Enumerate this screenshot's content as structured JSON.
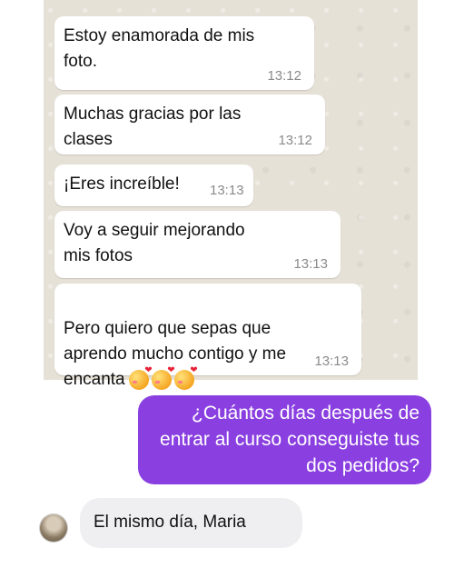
{
  "whatsapp_messages": [
    {
      "text": "Estoy enamorada de mis\nfoto.",
      "time": "13:12"
    },
    {
      "text": "Muchas gracias por las\nclases",
      "time": "13:12"
    },
    {
      "text": "¡Eres increíble!",
      "time": "13:13"
    },
    {
      "text": "Voy a seguir mejorando\nmis fotos",
      "time": "13:13"
    },
    {
      "text": "Pero quiero que sepas que\naprendo mucho contigo y me\nencanta",
      "time": "13:13",
      "emojis": [
        "smiling-face-with-hearts",
        "smiling-face-with-hearts",
        "smiling-face-with-hearts"
      ]
    }
  ],
  "dm": {
    "outgoing": "¿Cuántos días después de\nentrar al curso conseguiste tus\ndos pedidos?",
    "incoming": "El mismo día, Maria",
    "avatar_icon": "user-avatar"
  },
  "colors": {
    "whatsapp_bg": "#e6e1d7",
    "outgoing_bubble": "#8a3fe0",
    "incoming_bubble": "#efeff1"
  }
}
